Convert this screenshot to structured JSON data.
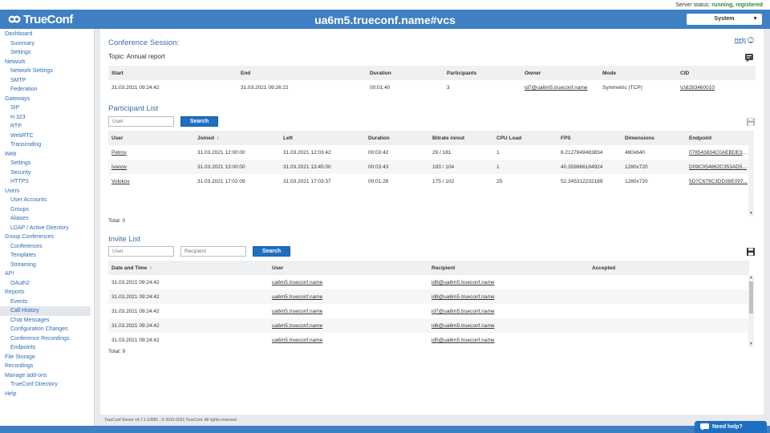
{
  "status": {
    "label": "Server status:",
    "value": "running, registered"
  },
  "header": {
    "logo_text": "TrueConf",
    "title": "ua6m5.trueconf.name#vcs",
    "select_value": "System"
  },
  "sidebar": {
    "items": [
      {
        "label": "Dashboard",
        "level": "top"
      },
      {
        "label": "Summary",
        "level": "sub"
      },
      {
        "label": "Settings",
        "level": "sub"
      },
      {
        "label": "Network",
        "level": "top"
      },
      {
        "label": "Network Settings",
        "level": "sub"
      },
      {
        "label": "SMTP",
        "level": "sub"
      },
      {
        "label": "Federation",
        "level": "sub"
      },
      {
        "label": "Gateways",
        "level": "top"
      },
      {
        "label": "SIP",
        "level": "sub"
      },
      {
        "label": "H.323",
        "level": "sub"
      },
      {
        "label": "RTP",
        "level": "sub"
      },
      {
        "label": "WebRTC",
        "level": "sub"
      },
      {
        "label": "Transcoding",
        "level": "sub"
      },
      {
        "label": "Web",
        "level": "top"
      },
      {
        "label": "Settings",
        "level": "sub"
      },
      {
        "label": "Security",
        "level": "sub"
      },
      {
        "label": "HTTPS",
        "level": "sub"
      },
      {
        "label": "Users",
        "level": "top"
      },
      {
        "label": "User Accounts",
        "level": "sub"
      },
      {
        "label": "Groups",
        "level": "sub"
      },
      {
        "label": "Aliases",
        "level": "sub"
      },
      {
        "label": "LDAP / Active Directory",
        "level": "sub"
      },
      {
        "label": "Group Conferences",
        "level": "top"
      },
      {
        "label": "Conferences",
        "level": "sub"
      },
      {
        "label": "Templates",
        "level": "sub"
      },
      {
        "label": "Streaming",
        "level": "sub"
      },
      {
        "label": "API",
        "level": "top"
      },
      {
        "label": "OAuth2",
        "level": "sub"
      },
      {
        "label": "Reports",
        "level": "top"
      },
      {
        "label": "Events",
        "level": "sub"
      },
      {
        "label": "Call History",
        "level": "sub",
        "active": true
      },
      {
        "label": "Chat Messages",
        "level": "sub"
      },
      {
        "label": "Configuration Changes",
        "level": "sub"
      },
      {
        "label": "Conference Recordings",
        "level": "sub"
      },
      {
        "label": "Endpoints",
        "level": "sub"
      },
      {
        "label": "File Storage",
        "level": "top"
      },
      {
        "label": "Recordings",
        "level": "top"
      },
      {
        "label": "Manage add-ons",
        "level": "top"
      },
      {
        "label": "TrueConf Directory",
        "level": "sub"
      },
      {
        "label": "Help",
        "level": "top"
      }
    ]
  },
  "session": {
    "title": "Conference Session:",
    "topic_label": "Topic:",
    "topic_value": "Annual report",
    "help": "Help",
    "columns": [
      "Start",
      "End",
      "Duration",
      "Participants",
      "Owner",
      "Mode",
      "CID"
    ],
    "row": [
      "31.03.2021 09:24:42",
      "31.03.2021 09:26:22",
      "00:01:40",
      "3",
      "id7@ua6m5.trueconf.name",
      "Symmetric (TCP)",
      "\\c\\8283460010"
    ]
  },
  "participants": {
    "title": "Participant List",
    "user_placeholder": "User",
    "search_label": "Search",
    "columns": [
      "User",
      "Joined",
      "Left",
      "Duration",
      "Bitrate in/out",
      "CPU Load",
      "FPS",
      "Dimensions",
      "Endpoint"
    ],
    "sort_icon": "arrow-up",
    "rows": [
      [
        "Petrov",
        "31.03.2021 12:00:00",
        "31.03.2021 12:03:42",
        "00:03:42",
        "29 / 181",
        "1",
        "6.2127849483834",
        "480x640",
        "078543834C0AEBDE34..."
      ],
      [
        "Ivanov",
        "31.03.2021 13:00:00",
        "31.03.2021 13:45:00",
        "00:03:43",
        "193 / 104",
        "1",
        "40.359966184924",
        "1280x720",
        "D09C054862C353AD5..."
      ],
      [
        "Volokov",
        "31.03.2021 17:02:09",
        "31.03.2021 17:03:37",
        "00:01:28",
        "175 / 102",
        "25",
        "52.345312232189",
        "1280x720",
        "5D7C679C3DD38E097..."
      ]
    ],
    "total": "Total: 0"
  },
  "invites": {
    "title": "Invite List",
    "user_placeholder": "User",
    "recipient_placeholder": "Recipient",
    "search_label": "Search",
    "columns": [
      "Date and Time",
      "User",
      "Recipient",
      "Accepted"
    ],
    "rows": [
      [
        "31.03.2021 09:24:42",
        "ua6m5.trueconf.name",
        "id9@ua6m5.trueconf.name",
        ""
      ],
      [
        "31.03.2021 09:24:42",
        "ua6m5.trueconf.name",
        "id8@ua6m5.trueconf.name",
        ""
      ],
      [
        "31.03.2021 09:24:42",
        "ua6m5.trueconf.name",
        "id7@ua6m5.trueconf.name",
        ""
      ],
      [
        "31.03.2021 09:24:42",
        "ua6m5.trueconf.name",
        "id6@ua6m5.trueconf.name",
        ""
      ],
      [
        "31.03.2021 09:24:42",
        "ua6m5.trueconf.name",
        "id5@ua6m5.trueconf.name",
        ""
      ]
    ],
    "total": "Total: 9"
  },
  "footer": {
    "text": "TrueConf Server v4.7.1.10050 , © 2010-2021 TrueConf. All rights reserved."
  },
  "need_help": {
    "label": "Need help?"
  },
  "colors": {
    "brand": "#3f7fc3",
    "button": "#1f6fc0",
    "status_ok": "#2e8b2e",
    "link": "#2a6cb7"
  }
}
